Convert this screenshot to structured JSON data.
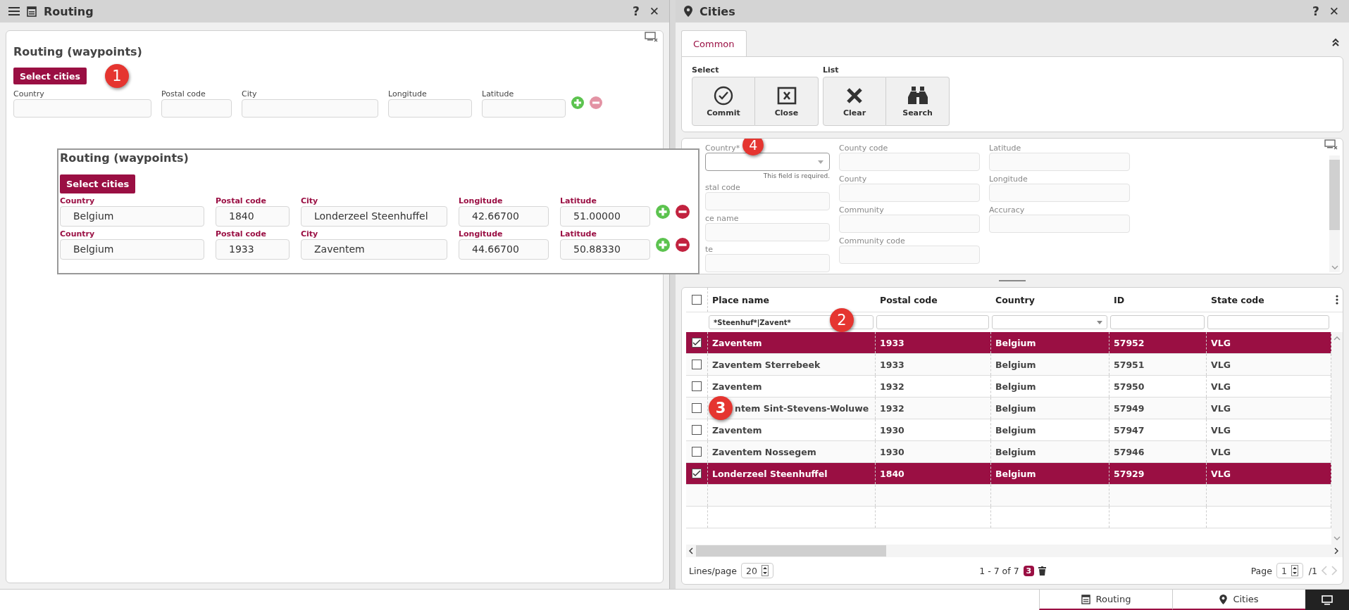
{
  "left_panel": {
    "title": "Routing",
    "actions": [
      "?",
      "✕"
    ],
    "card": {
      "heading": "Routing (waypoints)",
      "select_button": "Select cities",
      "callout": "1",
      "rows": [
        {
          "remove_disabled": true,
          "fields": [
            {
              "label": "Country"
            },
            {
              "label": "Postal code"
            },
            {
              "label": "City"
            },
            {
              "label": "Longitude"
            },
            {
              "label": "Latitude"
            }
          ]
        }
      ]
    }
  },
  "popup": {
    "heading": "Routing (waypoints)",
    "select_button": "Select cities",
    "rows": [
      {
        "remove_disabled": false,
        "fields": [
          {
            "label": "Country",
            "value": "Belgium"
          },
          {
            "label": "Postal code",
            "value": "1840"
          },
          {
            "label": "City",
            "value": "Londerzeel Steenhuffel"
          },
          {
            "label": "Longitude",
            "value": "42.66700"
          },
          {
            "label": "Latitude",
            "value": "51.00000"
          }
        ]
      },
      {
        "remove_disabled": false,
        "fields": [
          {
            "label": "Country",
            "value": "Belgium"
          },
          {
            "label": "Postal code",
            "value": "1933"
          },
          {
            "label": "City",
            "value": "Zaventem"
          },
          {
            "label": "Longitude",
            "value": "44.66700"
          },
          {
            "label": "Latitude",
            "value": "50.88330"
          }
        ]
      }
    ]
  },
  "right_panel": {
    "title": "Cities",
    "actions": [
      "?",
      "✕"
    ],
    "tabs": [
      {
        "label": "Common",
        "selected": true
      }
    ],
    "toolbar_groups": [
      {
        "label": "Select",
        "buttons": [
          {
            "kind": "commit",
            "label": "Commit"
          },
          {
            "kind": "close",
            "label": "Close"
          }
        ]
      },
      {
        "label": "List",
        "buttons": [
          {
            "kind": "clear",
            "label": "Clear"
          },
          {
            "kind": "search",
            "label": "Search"
          }
        ]
      }
    ],
    "filter_form": {
      "callout": "4",
      "columns": [
        [
          {
            "kind": "dropdown",
            "label": "Country*",
            "hint": "This field is required."
          },
          {
            "kind": "text",
            "label": "stal code"
          },
          {
            "kind": "text",
            "label": "ce name"
          },
          {
            "kind": "text",
            "label": "te"
          }
        ],
        [
          {
            "kind": "text",
            "label": "County code"
          },
          {
            "kind": "text",
            "label": "County"
          },
          {
            "kind": "text",
            "label": "Community"
          },
          {
            "kind": "text",
            "label": "Community code"
          }
        ],
        [
          {
            "kind": "text",
            "label": "Latitude"
          },
          {
            "kind": "text",
            "label": "Longitude"
          },
          {
            "kind": "text",
            "label": "Accuracy"
          }
        ]
      ]
    },
    "table": {
      "select_all_checked": false,
      "columns": [
        "Place name",
        "Postal code",
        "Country",
        "ID",
        "State code"
      ],
      "filters": [
        {
          "kind": "text",
          "value": "*Steenhuf*|Zavent*",
          "callout": "2"
        },
        {
          "kind": "text"
        },
        {
          "kind": "dropdown"
        },
        {
          "kind": "text"
        },
        {
          "kind": "text"
        }
      ],
      "rows": [
        {
          "selected": true,
          "cells": [
            "Zaventem",
            "1933",
            "Belgium",
            "57952",
            "VLG"
          ]
        },
        {
          "selected": false,
          "cells": [
            "Zaventem Sterrebeek",
            "1933",
            "Belgium",
            "57951",
            "VLG"
          ]
        },
        {
          "selected": false,
          "cells": [
            "Zaventem",
            "1932",
            "Belgium",
            "57950",
            "VLG"
          ]
        },
        {
          "selected": false,
          "callout": "3",
          "cells": [
            "ntem Sint-Stevens-Woluwe",
            "1932",
            "Belgium",
            "57949",
            "VLG"
          ]
        },
        {
          "selected": false,
          "cells": [
            "Zaventem",
            "1930",
            "Belgium",
            "57947",
            "VLG"
          ]
        },
        {
          "selected": false,
          "cells": [
            "Zaventem Nossegem",
            "1930",
            "Belgium",
            "57946",
            "VLG"
          ]
        },
        {
          "selected": true,
          "cells": [
            "Londerzeel Steenhuffel",
            "1840",
            "Belgium",
            "57929",
            "VLG"
          ]
        }
      ],
      "footer": {
        "lines_label": "Lines/page",
        "lines_value": "20",
        "range": "1 - 7 of 7",
        "selected_count": "3",
        "page_label": "Page",
        "page_value": "1",
        "page_total": "/1"
      }
    }
  },
  "taskbar": [
    {
      "kind": "calendar",
      "label": "Routing"
    },
    {
      "kind": "pin",
      "label": "Cities"
    }
  ]
}
